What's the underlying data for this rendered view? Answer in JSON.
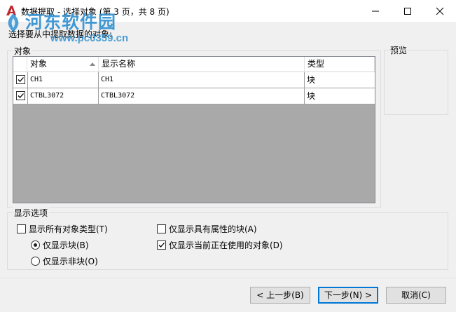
{
  "window": {
    "title": "数据提取 - 选择对象 (第 3 页，共 8 页)",
    "accent": "#c1272d"
  },
  "watermark": {
    "name": "河东软件园",
    "url": "www.pc0359.cn"
  },
  "prompt": "选择要从中提取数据的对象:",
  "objects_group": {
    "label": "对象",
    "columns": [
      "对象",
      "显示名称",
      "类型"
    ],
    "sort_indicator": "sort-ascending-icon",
    "rows": [
      {
        "checked": true,
        "object": "CH1",
        "display_name": "CH1",
        "type": "块"
      },
      {
        "checked": true,
        "object": "CTBL3072",
        "display_name": "CTBL3072",
        "type": "块"
      }
    ]
  },
  "preview": {
    "label": "预览"
  },
  "display_options": {
    "label": "显示选项",
    "show_all_types": {
      "label": "显示所有对象类型(T)",
      "checked": false
    },
    "only_blocks": {
      "label": "仅显示块(B)",
      "selected": true
    },
    "only_non_blocks": {
      "label": "仅显示非块(O)",
      "selected": false
    },
    "only_attr_blocks": {
      "label": "仅显示具有属性的块(A)",
      "checked": false
    },
    "only_in_use": {
      "label": "仅显示当前正在使用的对象(D)",
      "checked": true
    }
  },
  "buttons": {
    "back": "< 上一步(B)",
    "next": "下一步(N) >",
    "cancel": "取消(C)"
  }
}
